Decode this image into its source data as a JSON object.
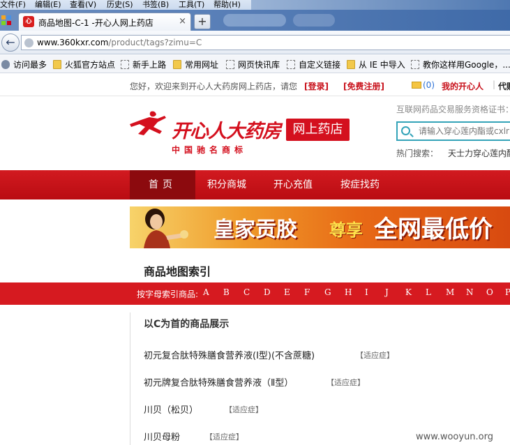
{
  "browser": {
    "menu": [
      "文件(F)",
      "编辑(E)",
      "查看(V)",
      "历史(S)",
      "书签(B)",
      "工具(T)",
      "帮助(H)"
    ],
    "tab_title": "商品地图-C-1 -开心人网上药店",
    "tab_favicon": "心",
    "tab_close": "×",
    "new_tab": "+",
    "back": "←",
    "url_host": "www.360kxr.com",
    "url_path": "/product/tags?zimu=C",
    "bookmarks": [
      "访问最多",
      "火狐官方站点",
      "新手上路",
      "常用网址",
      "网页快讯库",
      "自定义链接",
      "从 IE 中导入",
      "教你这样用Google，..."
    ]
  },
  "topbar": {
    "welcome": "您好，欢迎来到开心人大药房网上药店，请您",
    "login": "[登录]",
    "register": "[免费注册]",
    "mail_count": "(0)",
    "my_account": "我的开心人",
    "separator": "|",
    "more": "代购"
  },
  "logo": {
    "name": "开心人大药房",
    "shop": "网上药店",
    "tagline": "中国驰名商标"
  },
  "header": {
    "certificate": "互联网药品交易服务资格证书：",
    "search_placeholder": "请输入穿心莲内酯或cxlnz",
    "hot_label": "热门搜索：",
    "hot_term": "天士力穿心莲内酯"
  },
  "nav": {
    "items": [
      "首页",
      "积分商城",
      "开心充值",
      "按症找药"
    ]
  },
  "banner": {
    "text1": "皇家贡胶",
    "text2": "尊享",
    "text3": "全网最低价"
  },
  "index": {
    "title": "商品地图索引",
    "letter_label": "按字母索引商品:",
    "letters": [
      "A",
      "B",
      "C",
      "D",
      "E",
      "F",
      "G",
      "H",
      "I",
      "J",
      "K",
      "L",
      "M",
      "N",
      "O",
      "P"
    ]
  },
  "products": {
    "heading": "以C为首的商品展示",
    "indication_label": "【适应症】",
    "items": [
      "初元复合肽特殊膳食营养液(I型)(不含蔗糖)",
      "初元牌复合肽特殊膳食营养液（Ⅱ型）",
      "川贝（松贝）",
      "川贝母粉"
    ]
  },
  "watermark": "www.wooyun.org",
  "colors": {
    "brand_red": "#d4101e",
    "nav_red": "#c8151b",
    "nav_active": "#8c0a0e",
    "search_border": "#33a3b8"
  }
}
